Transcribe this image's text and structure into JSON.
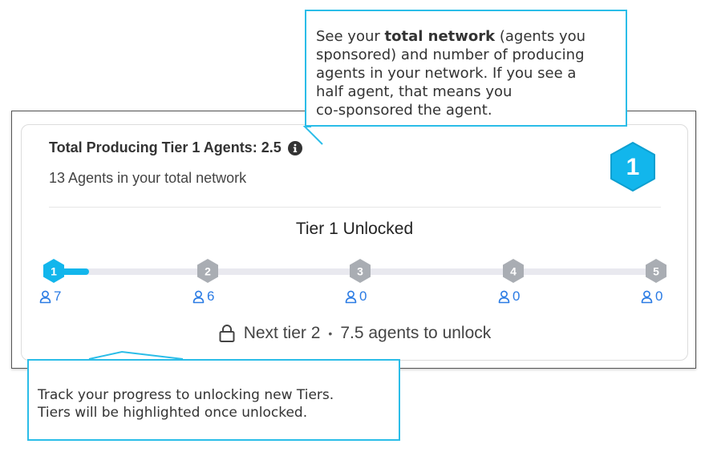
{
  "card": {
    "title": "Total Producing Tier 1 Agents: 2.5",
    "info_icon": "info-circle-icon",
    "subtitle": "13 Agents in your total network",
    "current_tier_badge": "1",
    "tier_status": "Tier 1 Unlocked",
    "progress_to_next_tier": 0.06,
    "tiers": [
      {
        "number": "1",
        "count": "7",
        "unlocked": true
      },
      {
        "number": "2",
        "count": "6",
        "unlocked": false
      },
      {
        "number": "3",
        "count": "0",
        "unlocked": false
      },
      {
        "number": "4",
        "count": "0",
        "unlocked": false
      },
      {
        "number": "5",
        "count": "0",
        "unlocked": false
      }
    ],
    "next_tier": {
      "lock_icon": "lock-icon",
      "label": "Next tier 2",
      "separator": "•",
      "unlock_text": "7.5 agents to unlock"
    }
  },
  "callouts": {
    "network": {
      "line1_pre": "See your ",
      "line1_bold": "total network",
      "line1_post": " (agents you",
      "line2": "sponsored) and number of producing",
      "line3": "agents in your network. If you see a",
      "line4": "half agent, that means you",
      "line5": "co-sponsored the agent."
    },
    "progress": {
      "line1": "Track your progress to unlocking new Tiers.",
      "line2": "Tiers will be highlighted once unlocked."
    }
  },
  "colors": {
    "accent": "#12b6ec",
    "locked": "#a9adb3",
    "count_text": "#2a7be4",
    "callout_border": "#2bbde8"
  }
}
